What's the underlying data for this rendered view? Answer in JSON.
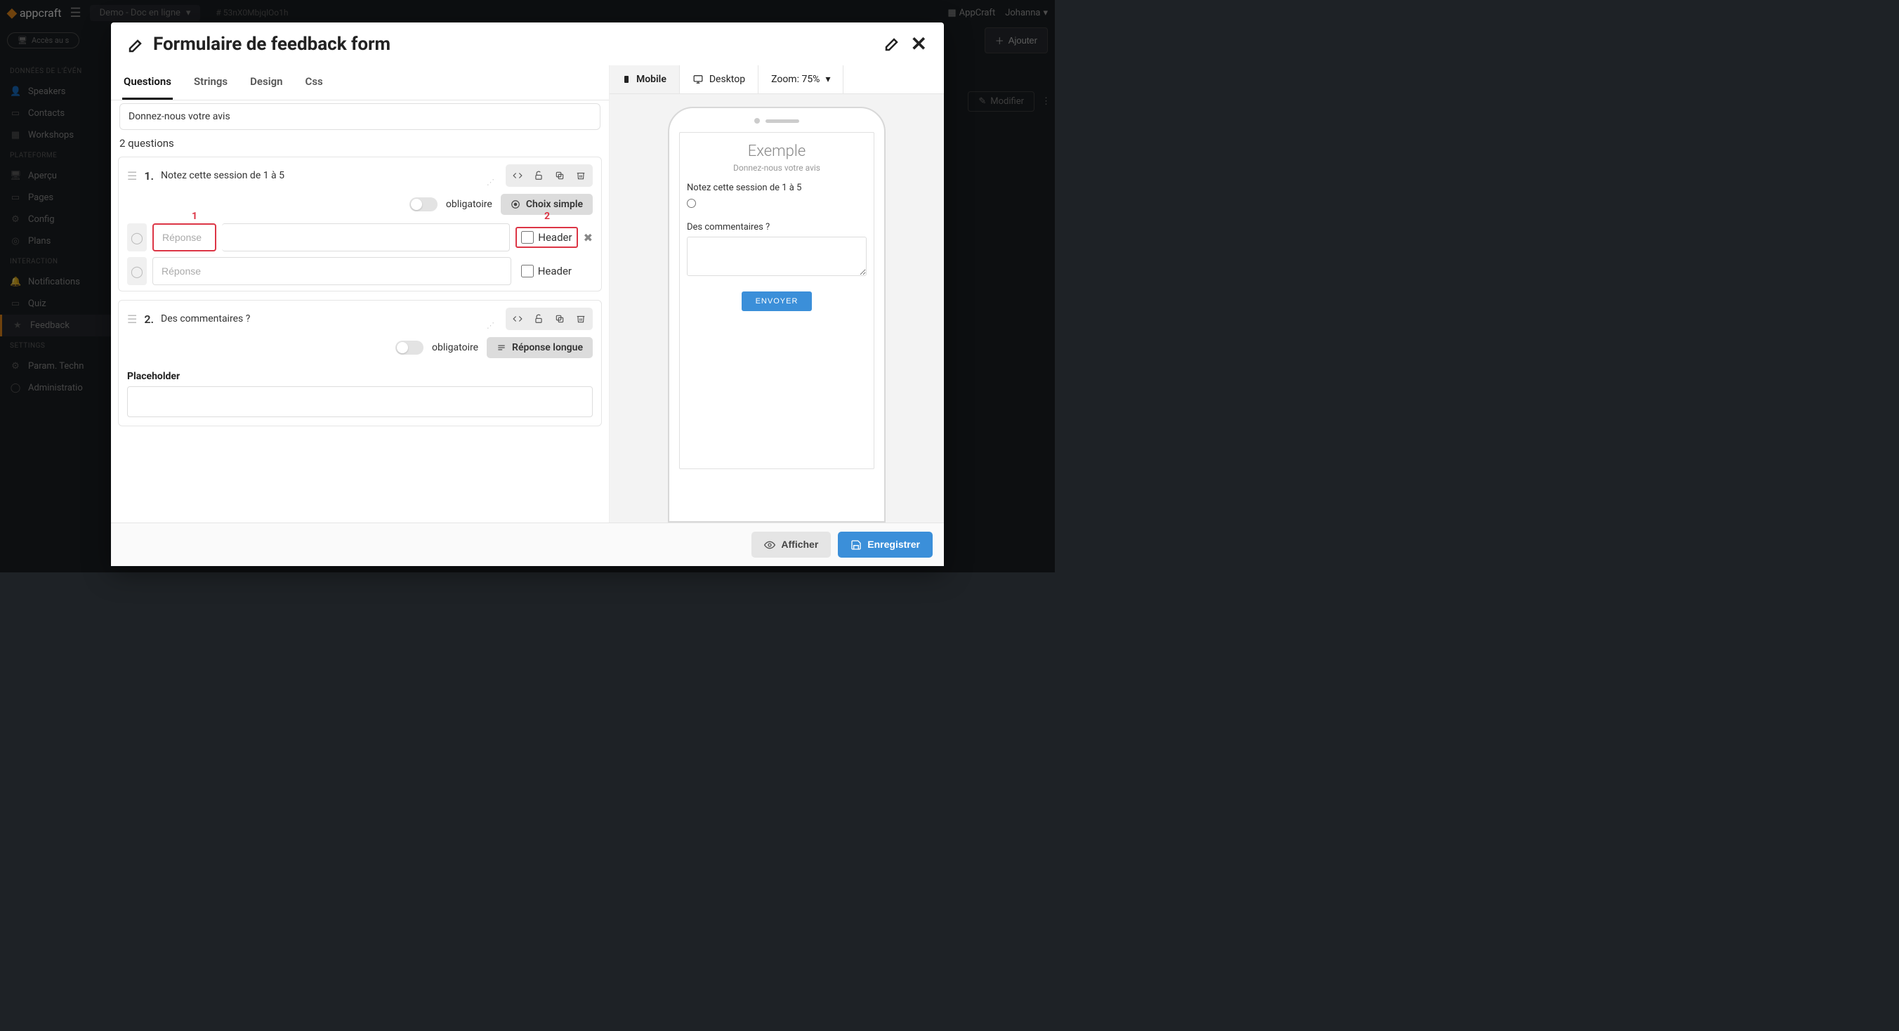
{
  "topbar": {
    "logo": "appcraft",
    "project": "Demo - Doc en ligne",
    "project_id": "# 53nX0MbjqlOo1h",
    "org": "AppCraft",
    "user": "Johanna",
    "access_btn": "Accès au s",
    "ajouter": "Ajouter",
    "modifier": "Modifier"
  },
  "sidebar": {
    "sections": {
      "data": "DONNÉES DE L'ÉVÉN",
      "platform": "PLATEFORME",
      "interaction": "INTERACTION",
      "settings": "SETTINGS"
    },
    "items": {
      "speakers": "Speakers",
      "contacts": "Contacts",
      "workshops": "Workshops",
      "apercu": "Aperçu",
      "pages": "Pages",
      "config": "Config",
      "plans": "Plans",
      "notifications": "Notifications",
      "quiz": "Quiz",
      "feedback": "Feedback",
      "param": "Param. Techn",
      "admin": "Administratio"
    }
  },
  "modal": {
    "title": "Formulaire de feedback form",
    "tabs": {
      "questions": "Questions",
      "strings": "Strings",
      "design": "Design",
      "css": "Css"
    },
    "description": "Donnez-nous votre avis",
    "questions_count": "2 questions",
    "questions": [
      {
        "num": "1.",
        "title": "Notez cette session de 1 à 5",
        "required_label": "obligatoire",
        "type_label": "Choix simple",
        "answers": [
          {
            "placeholder": "Réponse",
            "header_label": "Header",
            "annotation": "1",
            "annotation2": "2"
          },
          {
            "placeholder": "Réponse",
            "header_label": "Header"
          }
        ]
      },
      {
        "num": "2.",
        "title": "Des commentaires ?",
        "required_label": "obligatoire",
        "type_label": "Réponse longue",
        "placeholder_label": "Placeholder"
      }
    ],
    "preview": {
      "tabs": {
        "mobile": "Mobile",
        "desktop": "Desktop",
        "zoom": "Zoom: 75%"
      },
      "title": "Exemple",
      "subtitle": "Donnez-nous votre avis",
      "q1": "Notez cette session de 1 à 5",
      "q2": "Des commentaires ?",
      "submit": "ENVOYER"
    },
    "footer": {
      "afficher": "Afficher",
      "enregistrer": "Enregistrer"
    }
  }
}
